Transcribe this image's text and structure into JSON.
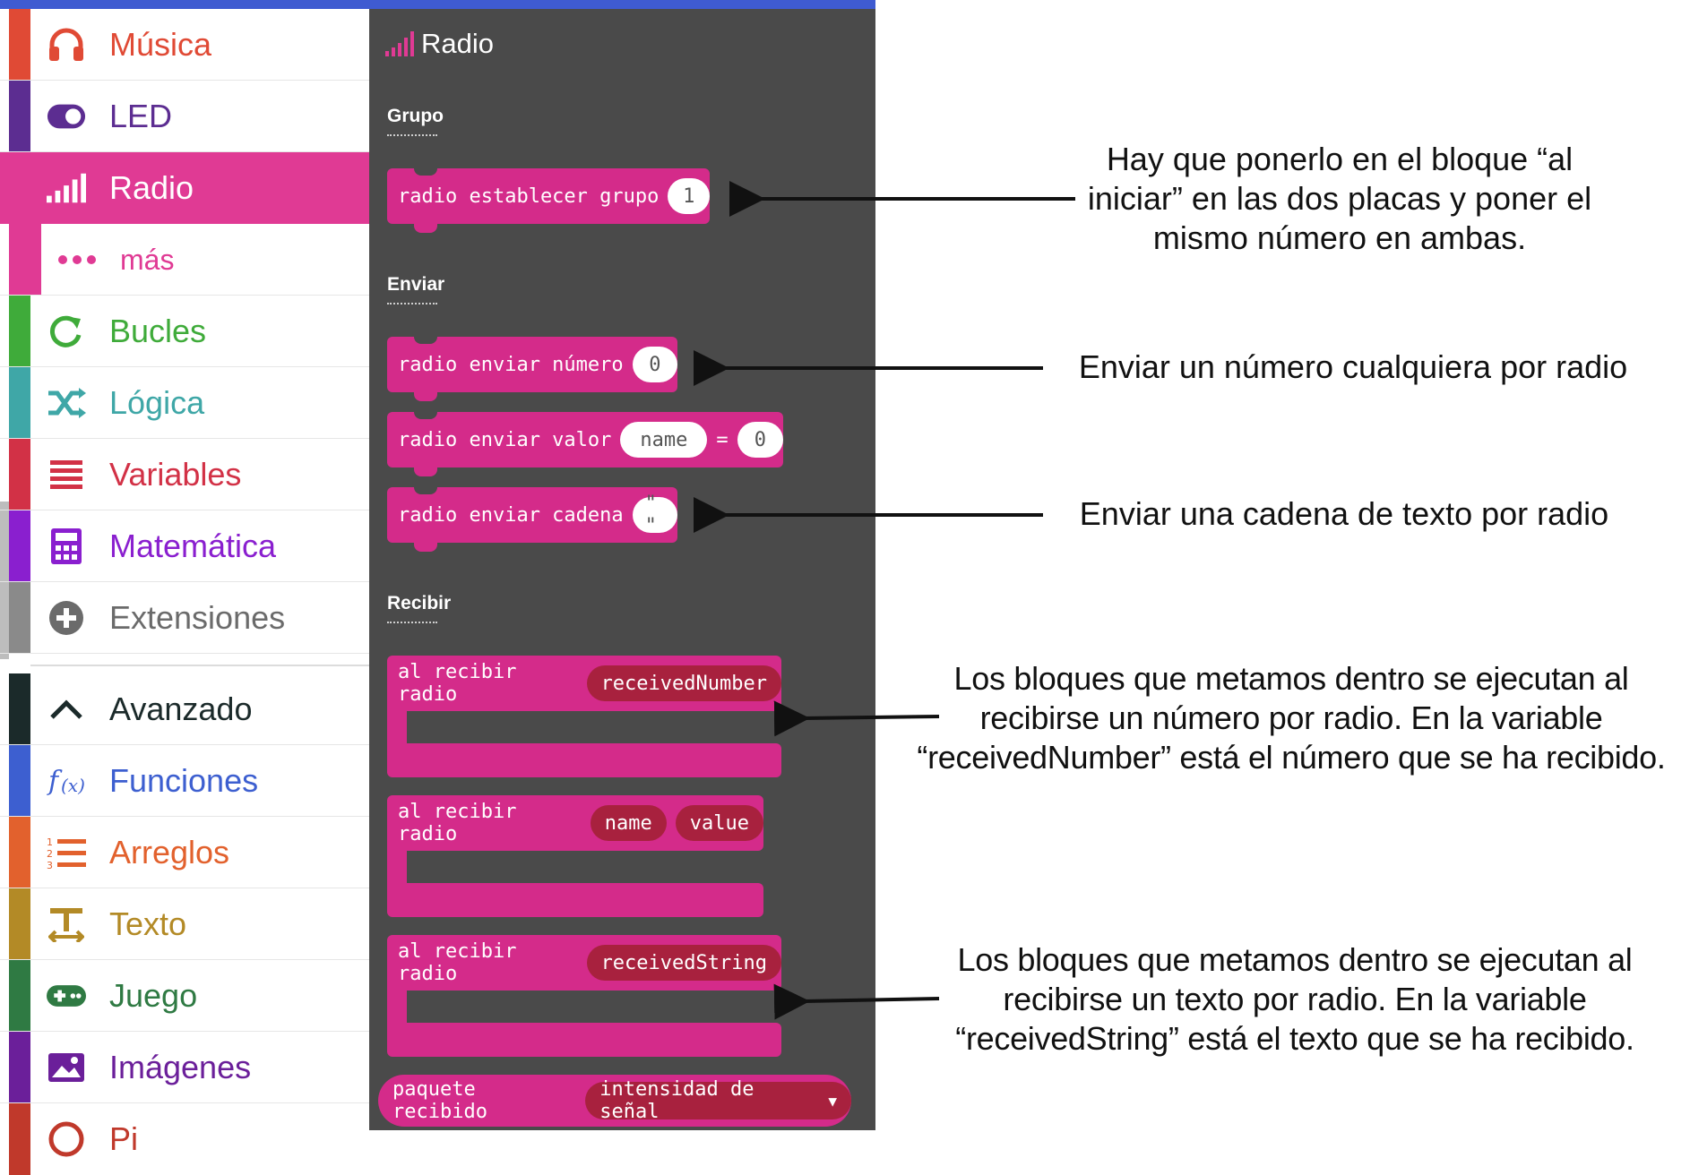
{
  "sidebar": {
    "categories": [
      {
        "label": "Música",
        "color": "#e04a35",
        "icon": "headphones-icon"
      },
      {
        "label": "LED",
        "color": "#5c2d91",
        "icon": "toggle-icon"
      },
      {
        "label": "Radio",
        "color": "#e03a94",
        "icon": "signal-bars-icon",
        "selected": true
      },
      {
        "label": "más",
        "color": "#e03a94",
        "icon": "more-dots-icon",
        "sub": true
      },
      {
        "label": "Bucles",
        "color": "#3fab3a",
        "icon": "loop-arrow-icon"
      },
      {
        "label": "Lógica",
        "color": "#3fa7a7",
        "icon": "shuffle-icon"
      },
      {
        "label": "Variables",
        "color": "#d23146",
        "icon": "list-lines-icon"
      },
      {
        "label": "Matemática",
        "color": "#8a1fcf",
        "icon": "calculator-icon"
      },
      {
        "label": "Extensiones",
        "color": "#6b6b6b",
        "icon": "plus-circle-icon"
      },
      {
        "label": "Avanzado",
        "color": "#1b2a2a",
        "icon": "chevron-up-icon"
      },
      {
        "label": "Funciones",
        "color": "#3d5fd0",
        "icon": "function-icon"
      },
      {
        "label": "Arreglos",
        "color": "#e2612d",
        "icon": "numbered-list-icon"
      },
      {
        "label": "Texto",
        "color": "#b38a26",
        "icon": "text-icon"
      },
      {
        "label": "Juego",
        "color": "#2f7a43",
        "icon": "gamepad-icon"
      },
      {
        "label": "Imágenes",
        "color": "#6b1f9a",
        "icon": "image-icon"
      },
      {
        "label": "Pi",
        "color": "#c0392b",
        "icon": "pins-icon"
      }
    ]
  },
  "flyout": {
    "title": "Radio",
    "headings": {
      "group": "Grupo",
      "send": "Enviar",
      "receive": "Recibir"
    },
    "blocks": {
      "set_group": {
        "label": "radio establecer grupo",
        "value": "1"
      },
      "send_number": {
        "label": "radio enviar número",
        "value": "0"
      },
      "send_value": {
        "label": "radio enviar valor",
        "name": "name",
        "eq": "=",
        "value": "0"
      },
      "send_string": {
        "label": "radio enviar cadena",
        "value": "\" \""
      },
      "on_number": {
        "label": "al recibir radio",
        "var": "receivedNumber"
      },
      "on_value": {
        "label": "al recibir radio",
        "var1": "name",
        "var2": "value"
      },
      "on_string": {
        "label": "al recibir radio",
        "var": "receivedString"
      },
      "packet": {
        "label": "paquete recibido",
        "option": "intensidad de señal"
      }
    }
  },
  "annotations": {
    "group": "Hay que ponerlo en el bloque “al iniciar” en las dos placas y poner el mismo número en ambas.",
    "send_number": "Enviar un número cualquiera por radio",
    "send_string": "Enviar una cadena de texto por radio",
    "on_number": "Los bloques que metamos dentro se ejecutan al recibirse un número por radio. En la variable “receivedNumber” está el número que se ha recibido.",
    "on_string": "Los bloques que metamos dentro se ejecutan al recibirse un texto por radio. En la variable “receivedString” está el texto que se ha recibido."
  },
  "colors": {
    "block": "#d42b8a",
    "variable": "#a8213e",
    "flyout_bg": "#4a4a4a",
    "topbar": "#3f5bd1"
  }
}
